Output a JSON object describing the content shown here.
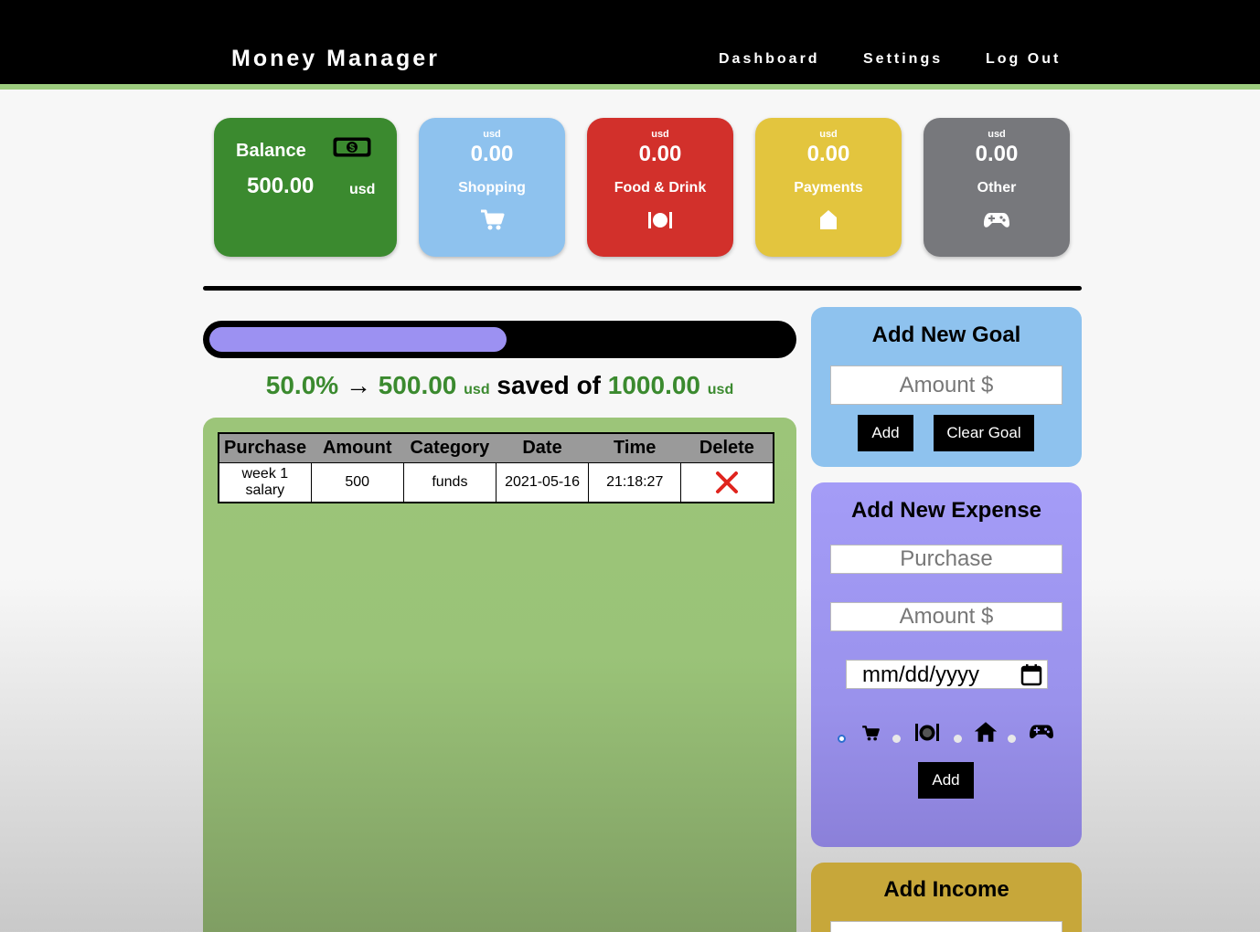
{
  "nav": {
    "brand": "Money Manager",
    "links": [
      "Dashboard",
      "Settings",
      "Log Out"
    ]
  },
  "balance": {
    "title": "Balance",
    "value": "500.00",
    "currency": "usd",
    "icon": "money-bill-icon"
  },
  "categories": [
    {
      "currency": "usd",
      "value": "0.00",
      "label": "Shopping",
      "icon": "shopping-cart-icon",
      "color": "#8ec2ee"
    },
    {
      "currency": "usd",
      "value": "0.00",
      "label": "Food & Drink",
      "icon": "utensils-icon",
      "color": "#d2302b"
    },
    {
      "currency": "usd",
      "value": "0.00",
      "label": "Payments",
      "icon": "home-icon",
      "color": "#e3c53e"
    },
    {
      "currency": "usd",
      "value": "0.00",
      "label": "Other",
      "icon": "gamepad-icon",
      "color": "#77787c"
    }
  ],
  "goal_progress": {
    "percent": "50.0%",
    "fraction": 0.5,
    "arrow": "→",
    "saved": "500.00",
    "currency": "usd",
    "saved_of": "saved of",
    "goal": "1000.00"
  },
  "transactions": {
    "headers": [
      "Purchase",
      "Amount",
      "Category",
      "Date",
      "Time",
      "Delete"
    ],
    "rows": [
      {
        "purchase": "week 1 salary",
        "amount": "500",
        "category": "funds",
        "date": "2021-05-16",
        "time": "21:18:27",
        "delete_icon": "delete-x-icon"
      }
    ]
  },
  "goal_form": {
    "title": "Add New Goal",
    "amount_placeholder": "Amount $",
    "add_label": "Add",
    "clear_label": "Clear Goal"
  },
  "expense_form": {
    "title": "Add New Expense",
    "purchase_placeholder": "Purchase",
    "amount_placeholder": "Amount $",
    "date_placeholder": "mm/dd/yyyy",
    "category_icons": [
      "shopping-cart-icon",
      "utensils-icon",
      "home-icon",
      "gamepad-icon"
    ],
    "add_label": "Add"
  },
  "income_form": {
    "title": "Add Income"
  },
  "colors": {
    "nav_bg": "#000000",
    "nav_accent": "#9ccb7e",
    "balance_green": "#3b8a2f",
    "progress_fill": "#9c91f2",
    "delete_red": "#e0241d"
  }
}
